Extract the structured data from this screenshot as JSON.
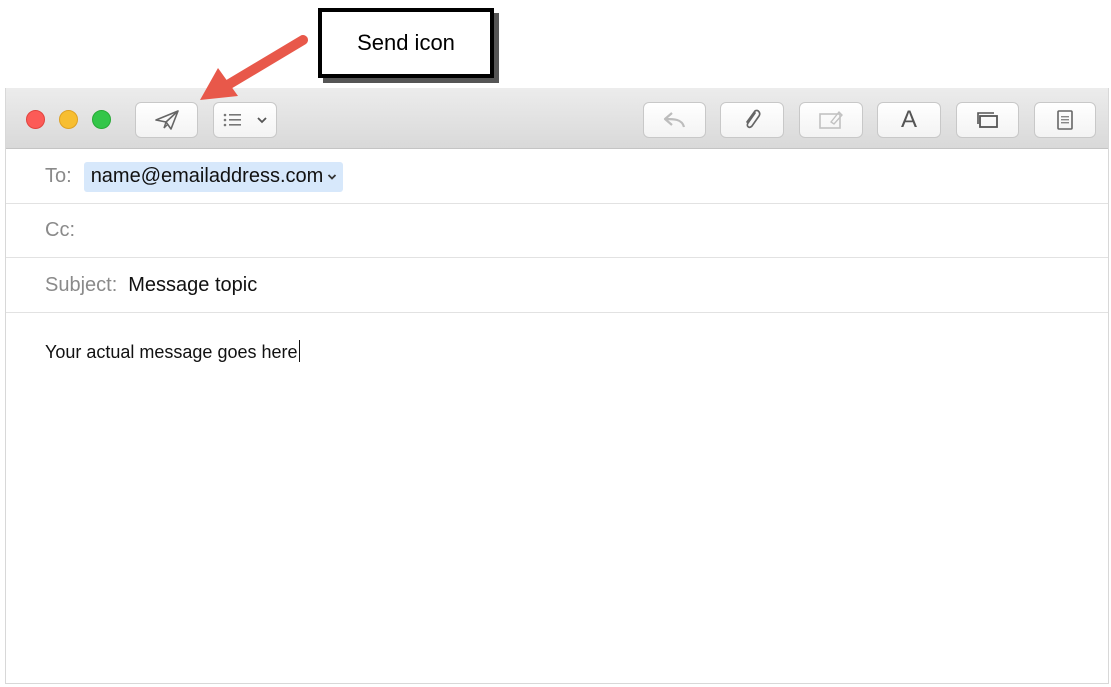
{
  "annotation": {
    "label": "Send icon"
  },
  "toolbar": {
    "send_icon": "paper-plane-icon",
    "header_fields_icon": "list-icon",
    "reply_icon": "reply-arrow-icon",
    "attach_icon": "paperclip-icon",
    "markup_icon": "photo-browser-icon",
    "format_label": "A",
    "window_icon": "window-icon",
    "stationery_icon": "stationery-icon"
  },
  "compose": {
    "to_label": "To:",
    "to_value": "name@emailaddress.com",
    "cc_label": "Cc:",
    "cc_value": "",
    "subject_label": "Subject:",
    "subject_value": "Message topic",
    "body_text": "Your actual message goes here"
  },
  "colors": {
    "arrow": "#e8584a",
    "close": "#fc5b57",
    "minimize": "#f7be31",
    "zoom": "#33c649",
    "token_bg": "#d7e8fb"
  }
}
